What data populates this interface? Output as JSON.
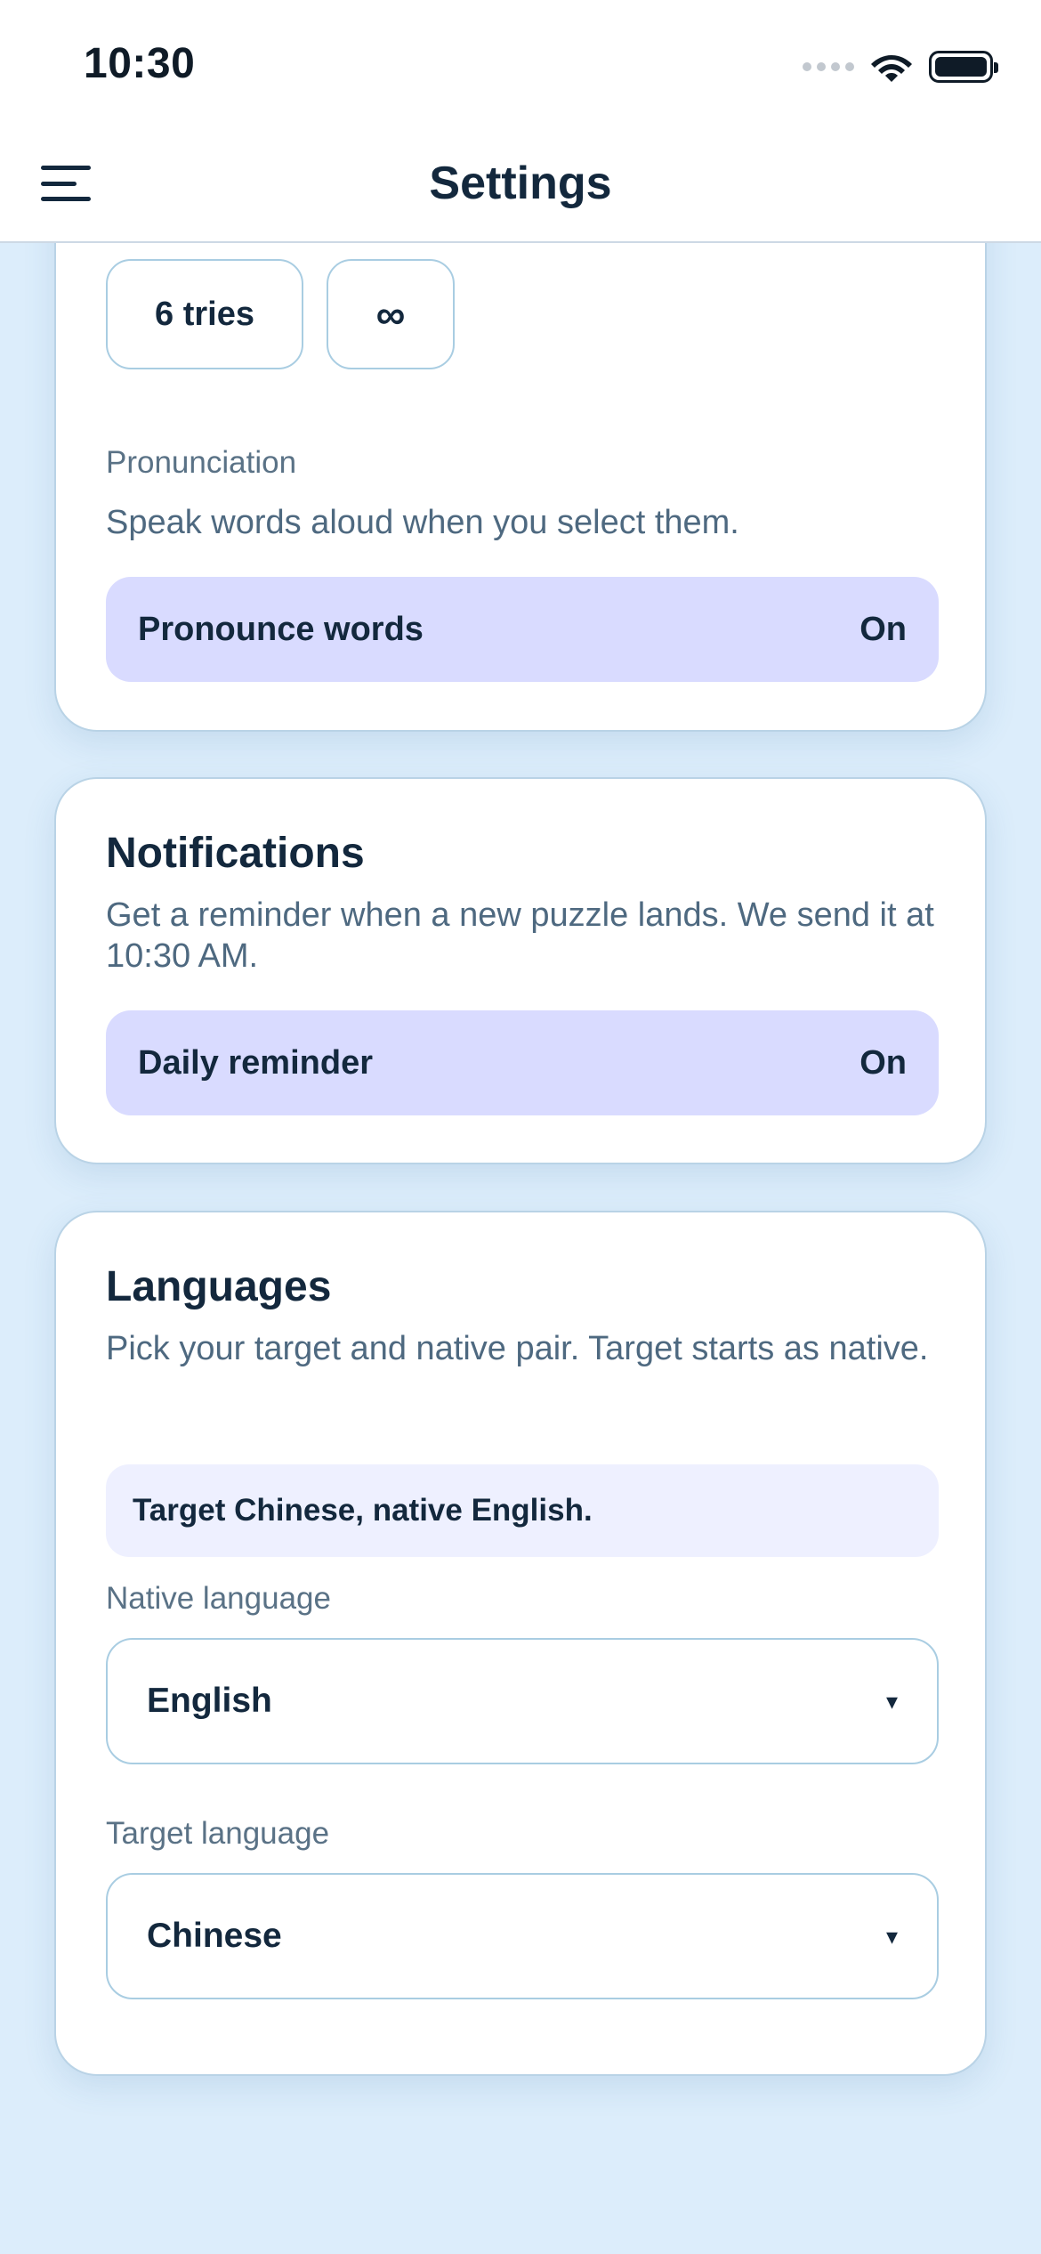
{
  "status_bar": {
    "time": "10:30"
  },
  "header": {
    "title": "Settings"
  },
  "attempts": {
    "options": [
      "6 tries",
      "∞"
    ]
  },
  "pronunciation": {
    "label": "Pronunciation",
    "description": "Speak words aloud when you select them.",
    "toggle_label": "Pronounce words",
    "toggle_state": "On"
  },
  "notifications": {
    "title": "Notifications",
    "description": "Get a reminder when a new puzzle lands. We send it at 10:30 AM.",
    "toggle_label": "Daily reminder",
    "toggle_state": "On"
  },
  "languages": {
    "title": "Languages",
    "description": "Pick your target and native pair. Target starts as native.",
    "summary": "Target Chinese, native English.",
    "native_label": "Native language",
    "native_value": "English",
    "target_label": "Target language",
    "target_value": "Chinese",
    "caret": "▾"
  },
  "colors": {
    "background": "#dcedfb",
    "card": "#ffffff",
    "toggle_bg": "#d9dbff",
    "summary_bg": "#eef0ff",
    "border": "#a9cde2",
    "text": "#13283d",
    "muted_text": "#4e6980"
  }
}
